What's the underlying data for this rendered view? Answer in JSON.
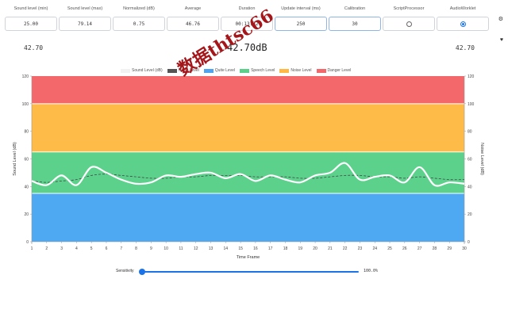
{
  "stats": [
    {
      "label": "Sound level (min)",
      "value": "25.00",
      "type": "readout"
    },
    {
      "label": "Sound level (max)",
      "value": "79.14",
      "type": "readout"
    },
    {
      "label": "Normalized (dB)",
      "value": "0.75",
      "type": "readout"
    },
    {
      "label": "Average",
      "value": "46.76",
      "type": "readout"
    },
    {
      "label": "Duration",
      "value": "00:13:22",
      "type": "readout"
    },
    {
      "label": "Update interval (ms)",
      "value": "250",
      "type": "input"
    },
    {
      "label": "Calibration",
      "value": "30",
      "type": "input"
    },
    {
      "label": "ScriptProcessor",
      "value": "",
      "type": "radio",
      "checked": false
    },
    {
      "label": "AudioWorklet",
      "value": "",
      "type": "radio",
      "checked": true
    }
  ],
  "side_icons": [
    "settings-icon",
    "heart-icon"
  ],
  "readouts": {
    "left": "42.70",
    "center": "42.70dB",
    "right": "42.70"
  },
  "watermark": "数据thtsc66",
  "slider": {
    "label": "Sensitivity",
    "value": "100.0%",
    "fraction": 0.0
  },
  "chart_data": {
    "type": "line",
    "legend": [
      {
        "name": "Sound Level (dB)",
        "color": "#f2f2f2"
      },
      {
        "name": "Noise Level",
        "color": "#555555"
      },
      {
        "name": "Quite Level",
        "color": "#4fa3ef"
      },
      {
        "name": "Speech Level",
        "color": "#5ccf8b"
      },
      {
        "name": "Noise Level",
        "color": "#ffb745"
      },
      {
        "name": "Danger Level",
        "color": "#f2686b"
      }
    ],
    "bands": [
      {
        "name": "Quite Level",
        "from": 0,
        "to": 35,
        "color": "#4fa9f2"
      },
      {
        "name": "Speech Level",
        "from": 35,
        "to": 65,
        "color": "#5cd18c"
      },
      {
        "name": "Noise Level",
        "from": 65,
        "to": 100,
        "color": "#ffbb47"
      },
      {
        "name": "Danger Level",
        "from": 100,
        "to": 120,
        "color": "#f2686b"
      }
    ],
    "ylim": [
      0,
      120
    ],
    "yticks": [
      0,
      20,
      40,
      60,
      80,
      100,
      120
    ],
    "ylabel_left": "Sound Level (dB)",
    "ylabel_right": "Noise Level (dB)",
    "xlabel": "Time Frame",
    "x": [
      1,
      2,
      3,
      4,
      5,
      6,
      7,
      8,
      9,
      10,
      11,
      12,
      13,
      14,
      15,
      16,
      17,
      18,
      19,
      20,
      21,
      22,
      23,
      24,
      25,
      26,
      27,
      28,
      29,
      30
    ],
    "series": [
      {
        "name": "Sound Level (dB)",
        "color": "#ffffff",
        "values": [
          44,
          41,
          48,
          41,
          54,
          50,
          45,
          42,
          43,
          48,
          47,
          49,
          50,
          46,
          49,
          44,
          48,
          45,
          43,
          48,
          50,
          57,
          45,
          47,
          48,
          43,
          54,
          41,
          43,
          42
        ]
      },
      {
        "name": "Noise Level",
        "color": "#444444",
        "values": [
          44,
          43,
          44,
          45,
          48,
          49,
          48,
          47,
          46,
          46,
          47,
          47,
          48,
          48,
          48,
          47,
          47,
          47,
          46,
          46,
          47,
          48,
          48,
          47,
          47,
          46,
          47,
          46,
          45,
          45
        ]
      }
    ]
  }
}
